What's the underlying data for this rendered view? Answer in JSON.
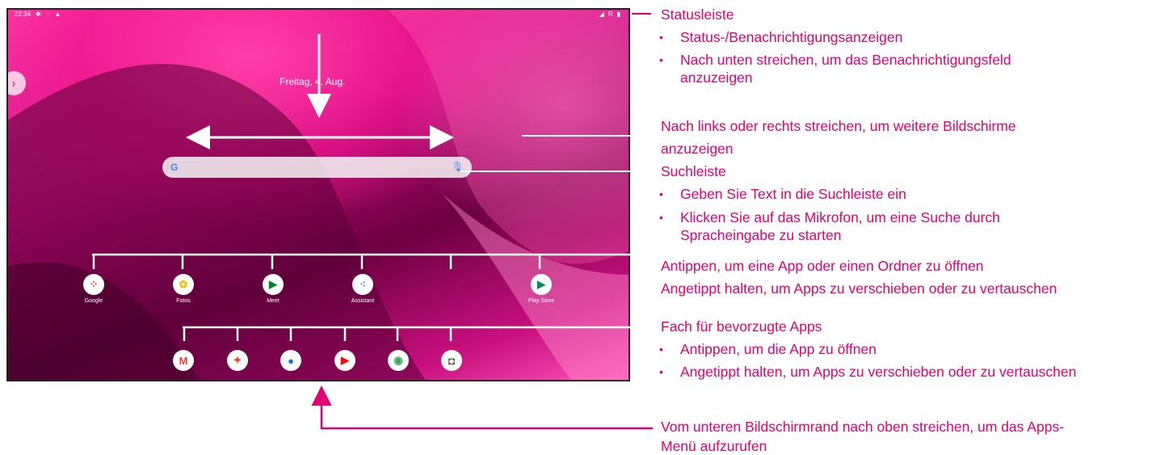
{
  "statusbar": {
    "time": "22:34",
    "right_text": "R"
  },
  "home": {
    "date": "Freitag, 4. Aug."
  },
  "search": {
    "g_letter": "G",
    "icon": "mic-icon"
  },
  "apps": [
    {
      "label": "Google",
      "icon": "google-folder-icon",
      "glyph": "⁘",
      "color": "#ea4335"
    },
    {
      "label": "Fotos",
      "icon": "photos-icon",
      "glyph": "✿",
      "color": "#fbbc04"
    },
    {
      "label": "Meet",
      "icon": "meet-icon",
      "glyph": "▶",
      "color": "#00832d"
    },
    {
      "label": "Assistant",
      "icon": "assistant-icon",
      "glyph": "⁖",
      "color": "#4285f4"
    },
    {
      "label": "Play Store",
      "icon": "play-store-icon",
      "glyph": "▶",
      "color": "#01875f"
    }
  ],
  "dock": [
    {
      "icon": "gmail-icon",
      "glyph": "M",
      "color": "#ea4335"
    },
    {
      "icon": "assistant-star-icon",
      "glyph": "✦",
      "color": "#ea4335"
    },
    {
      "icon": "messages-icon",
      "glyph": "●",
      "color": "#1a73e8"
    },
    {
      "icon": "youtube-icon",
      "glyph": "▶",
      "color": "#ff0000"
    },
    {
      "icon": "chrome-icon",
      "glyph": "◉",
      "color": "#34a853"
    },
    {
      "icon": "camera-icon",
      "glyph": "◘",
      "color": "#3c4043"
    }
  ],
  "callouts": {
    "statusbar": {
      "title": "Statusleiste",
      "b1": "Status-/Benachrichtigungsanzeigen",
      "b2a": "Nach unten streichen, um das Benachrichtigungsfeld",
      "b2b": "anzuzeigen"
    },
    "swipe": {
      "l1": "Nach links oder rechts streichen, um weitere Bildschirme",
      "l2": "anzuzeigen"
    },
    "searchbar": {
      "title": "Suchleiste",
      "b1": "Geben Sie Text in die Suchleiste ein",
      "b2a": "Klicken Sie auf das Mikrofon, um eine Suche durch",
      "b2b": "Spracheingabe zu starten"
    },
    "apps": {
      "l1": "Antippen, um eine App oder einen Ordner zu öffnen",
      "l2": "Angetippt halten, um Apps zu verschieben oder zu vertauschen"
    },
    "favorites": {
      "title": "Fach für bevorzugte Apps",
      "b1": "Antippen, um die App zu öffnen",
      "b2": "Angetippt halten, um Apps zu verschieben oder zu vertauschen"
    },
    "appsmenu": {
      "l1": "Vom unteren Bildschirmrand nach oben streichen, um das Apps-",
      "l2": "Menü aufzurufen"
    }
  },
  "colors": {
    "accent": "#e20074",
    "screen_border": "#222222"
  }
}
